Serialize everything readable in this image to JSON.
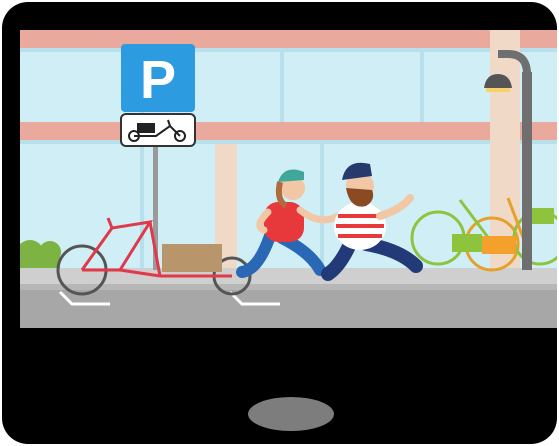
{
  "device": {
    "frame_color": "#000000",
    "home_button_color": "#7d7d7d",
    "home_button_icon": "oval-home-button"
  },
  "scene": {
    "type": "animated-video-frame",
    "parking_sign": {
      "letter": "P",
      "sign_color": "#2d9be0",
      "subsign_icon": "cargo-bike-icon"
    },
    "colors": {
      "sky": "#cfeef6",
      "building_stripe": "#e9a99d",
      "pillar": "#f1d9c8",
      "sidewalk": "#cfcfcf",
      "curb": "#b7b7b7",
      "road": "#a7a7a7",
      "parking_lines": "#ffffff",
      "cargo_bike": "#e0394a",
      "cargo_box": "#b8956a"
    },
    "characters": [
      {
        "role": "woman-running",
        "helmet_color": "#3fa89a",
        "shirt_color": "#e7383b",
        "pants_color": "#2a67b5"
      },
      {
        "role": "bearded-man-running",
        "helmet_color": "#283a6b",
        "shirt_color": "#e7383b",
        "pants_color": "#233a78"
      }
    ],
    "parked_bikes": [
      {
        "color": "#8ec33d",
        "basket": "#8ec33d"
      },
      {
        "color": "#e6a12b",
        "basket": "#f3a02d"
      },
      {
        "color": "#8ec33d",
        "basket": "#8ec33d"
      }
    ],
    "streetlamp": {
      "pole_color": "#6f6f6f",
      "lamp_glow": "#f6d36a"
    }
  }
}
